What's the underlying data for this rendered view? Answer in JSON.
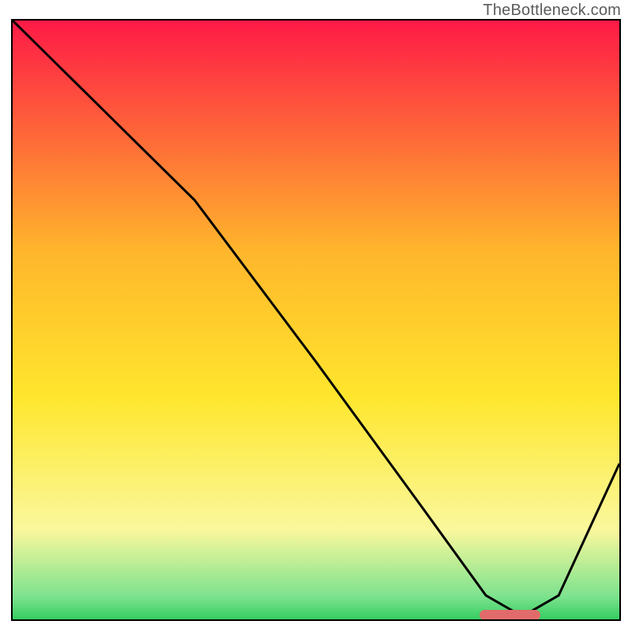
{
  "watermark": "TheBottleneck.com",
  "chart_data": {
    "type": "line",
    "title": "",
    "xlabel": "",
    "ylabel": "",
    "xlim": [
      0,
      100
    ],
    "ylim": [
      0,
      100
    ],
    "grid": false,
    "legend": false,
    "background_gradient": {
      "top": "#fe1a46",
      "upper_mid": "#ffb62c",
      "mid": "#ffe62d",
      "lower": "#faf89d",
      "near_bottom": "#7ce28e",
      "bottom": "#1cc651"
    },
    "series": [
      {
        "name": "bottleneck-curve",
        "x": [
          0,
          8,
          22,
          30,
          50,
          68,
          78,
          84,
          90,
          100
        ],
        "values": [
          100,
          92,
          78,
          70,
          43,
          18,
          4,
          0.5,
          4,
          26
        ],
        "stroke": "#000000"
      }
    ],
    "marker": {
      "name": "optimal-range",
      "x_start": 77,
      "x_end": 87,
      "y": 0.8,
      "color": "#e16b6b"
    }
  }
}
